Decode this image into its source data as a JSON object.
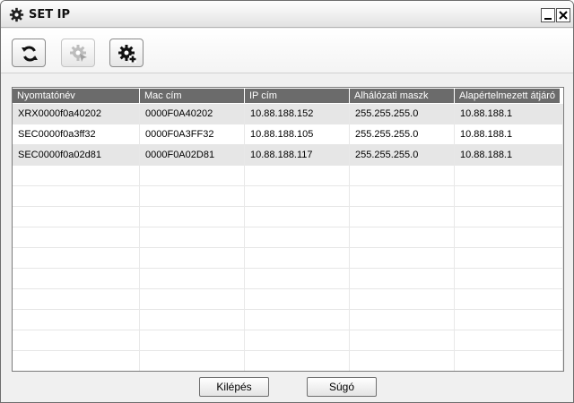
{
  "window": {
    "title": "SET IP",
    "title_icon": "gear-icon",
    "controls": [
      "minimize-icon",
      "close-icon"
    ]
  },
  "toolbar": {
    "buttons": [
      {
        "name": "refresh",
        "icon": "refresh-icon",
        "enabled": true
      },
      {
        "name": "configure",
        "icon": "gear-cursor-icon",
        "enabled": false
      },
      {
        "name": "add",
        "icon": "gear-plus-icon",
        "enabled": true
      }
    ]
  },
  "table": {
    "columns": [
      "Nyomtatónév",
      "Mac cím",
      "IP cím",
      "Alhálózati maszk",
      "Alapértelmezett átjáró"
    ],
    "rows": [
      [
        "XRX0000f0a40202",
        "0000F0A40202",
        "10.88.188.152",
        "255.255.255.0",
        "10.88.188.1"
      ],
      [
        "SEC0000f0a3ff32",
        "0000F0A3FF32",
        "10.88.188.105",
        "255.255.255.0",
        "10.88.188.1"
      ],
      [
        "SEC0000f0a02d81",
        "0000F0A02D81",
        "10.88.188.117",
        "255.255.255.0",
        "10.88.188.1"
      ]
    ],
    "selected_row": 0
  },
  "footer": {
    "exit_label": "Kilépés",
    "help_label": "Súgó"
  },
  "colors": {
    "header_bg": "#6b6b6b",
    "row_shade": "#e6e6e6",
    "window_bg": "#f0f0f0"
  }
}
